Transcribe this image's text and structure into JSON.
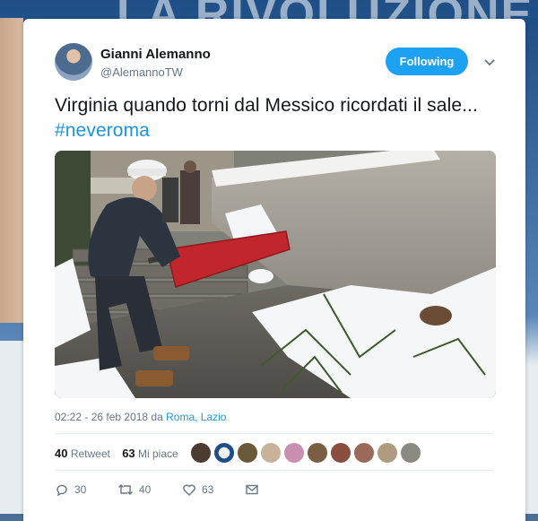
{
  "background": {
    "banner_text": "LA RIVOLUZIONE"
  },
  "tweet": {
    "author_name": "Gianni Alemanno",
    "author_handle": "@AlemannoTW",
    "follow_label": "Following",
    "text_main": "Virginia quando torni dal Messico ricordati il sale... ",
    "hashtag": "#neveroma",
    "timestamp": "02:22 - 26 feb 2018 da ",
    "place": "Roma, Lazio",
    "retweets_count": "40",
    "retweets_label": "Retweet",
    "likes_count": "63",
    "likes_label": "Mi piace",
    "actions": {
      "replies": "30",
      "retweets": "40",
      "likes": "63"
    }
  },
  "colors": {
    "accent": "#1da1f2",
    "link": "#1b95e0",
    "text": "#14171a",
    "muted": "#657786",
    "shovel": "#c0262b"
  },
  "icons": [
    "chevron-down-icon",
    "reply-icon",
    "retweet-icon",
    "heart-icon",
    "message-icon"
  ]
}
